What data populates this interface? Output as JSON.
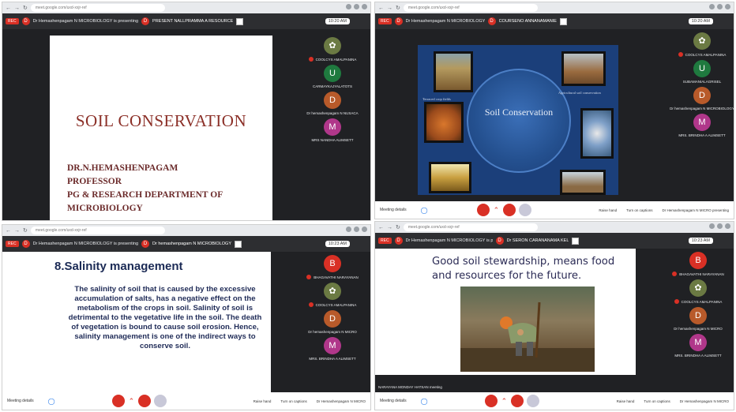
{
  "quad1": {
    "meet_title": "Dr Hemashenpagam N MICROBIOLOGY is presenting",
    "alt_title": "PRESENT NALLPRAMMA A RESOURCE",
    "time": "10:20 AM",
    "slide_title": "SOIL CONSERVATION",
    "slide_lines": [
      "DR.N.HEMASHENPAGAM",
      "PROFESSOR",
      "PG & RESEARCH DEPARTMENT OF",
      "MICROBIOLOGY"
    ],
    "participants": [
      {
        "initial": "",
        "name": "COOLCYS AMALPANINA",
        "color": "#6b7a43"
      },
      {
        "initial": "U",
        "name": "CARMAYKAJYALATOTS",
        "color": "#1f7a3f"
      },
      {
        "initial": "D",
        "name": "Dr hemashenpagam N NUSACA",
        "color": "#b85a2a"
      },
      {
        "initial": "M",
        "name": "MRS NANDHA ALIMSETT",
        "color": "#b0378a"
      }
    ]
  },
  "quad2": {
    "meet_title": "Dr Hemashenpagam N MICROBIOLOGY is presenting",
    "alt_title": "COURSENO ANNANAMANIE",
    "time": "10:20 AM",
    "slide_center": "Soil Conservation",
    "small_left": "Terraced crop fields",
    "small_right": "Agricultural soil conservation",
    "participants": [
      {
        "initial": "",
        "name": "COOLCYS AMALPANINA",
        "color": "#6b7a43"
      },
      {
        "initial": "U",
        "name": "SUBAMANIALAGRISEL",
        "color": "#1f7a3f"
      },
      {
        "initial": "D",
        "name": "Dr hemashenpagam N MICROBIOLOGY",
        "color": "#b85a2a"
      },
      {
        "initial": "M",
        "name": "MRS. BRINDHA A ALIMSETT",
        "color": "#b0378a"
      }
    ],
    "controls": {
      "details": "Meeting details",
      "right": [
        "Raise hand",
        "Turn on captions",
        "Dr Hemashenpagam N MICRO presenting"
      ]
    }
  },
  "quad3": {
    "meet_title": "Dr Hemashenpagam N MICROBIOLOGY is presenting",
    "alt_title": "Dr hemashenpagam N MICROBIOLOGY",
    "time": "10:23 AM",
    "heading": "8.Salinity management",
    "body": "The salinity of soil that is caused by the excessive accumulation of salts, has a negative effect on the metabolism of the crops in soil. Salinity of soil is detrimental to the vegetative life in the soil. The death of vegetation is bound to cause soil erosion. Hence, salinity management is one of the indirect ways to conserve soil.",
    "participants": [
      {
        "initial": "B",
        "name": "BHAGAVATHI NARAYANAN",
        "color": "#d93025"
      },
      {
        "initial": "",
        "name": "COOLCYS AMALPANINA",
        "color": "#6b7a43"
      },
      {
        "initial": "D",
        "name": "Dr hemashenpagam N MICRO",
        "color": "#b85a2a"
      },
      {
        "initial": "M",
        "name": "MRS. BRINDHA A ALIMSETT",
        "color": "#b0378a"
      }
    ],
    "controls": {
      "details": "Meeting details",
      "right": [
        "Raise hand",
        "Turn on captions",
        "Dr Hemashenpagam N MICRO"
      ]
    }
  },
  "quad4": {
    "meet_title": "Dr Hemashenpagam N MICROBIOLOGY is presenting",
    "alt_title": "Dr SERON CARANANAMA KEL",
    "time": "10:23 AM",
    "slide_text": "Good soil stewardship, means food and    resources for the future.",
    "caption": "NARAYANA MONDAY HATSAN meeting",
    "participants": [
      {
        "initial": "B",
        "name": "BHAGAVATHI NARAYANAN",
        "color": "#d93025"
      },
      {
        "initial": "",
        "name": "COOLCYS AMALPANINA",
        "color": "#6b7a43"
      },
      {
        "initial": "D",
        "name": "Dr hemashenpagam N MICRO",
        "color": "#b85a2a"
      },
      {
        "initial": "M",
        "name": "MRS. BRINDHA A ALIMSETT",
        "color": "#b0378a"
      }
    ],
    "controls": {
      "details": "Meeting details",
      "right": [
        "Raise hand",
        "Turn on captions",
        "Dr Hemashenpagam N MICRO"
      ]
    }
  },
  "common": {
    "rec": "REC",
    "url": "meet.google.com/uxd-xxjr-ref"
  }
}
